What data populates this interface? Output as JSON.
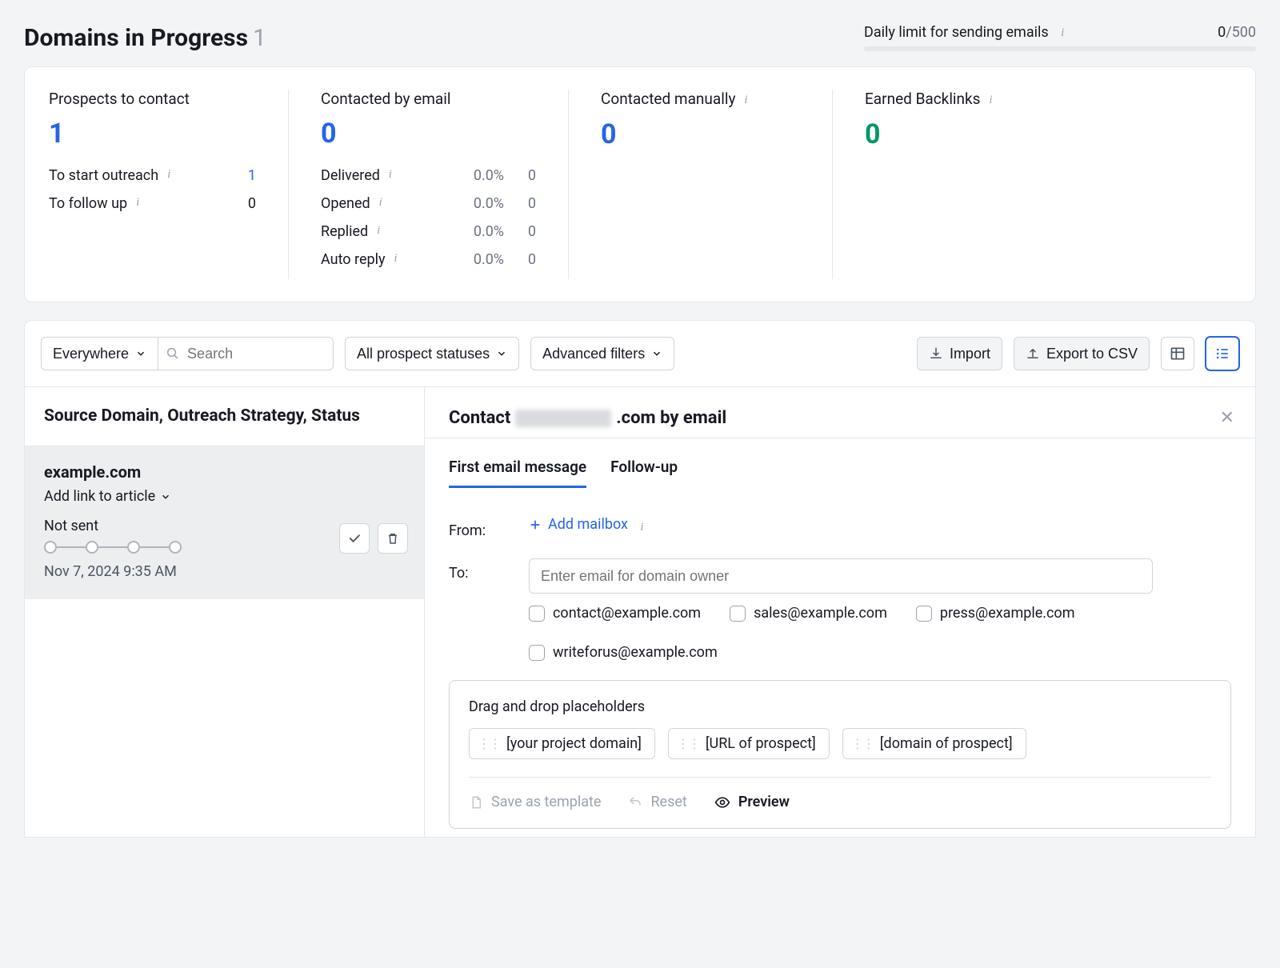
{
  "header": {
    "title": "Domains in Progress",
    "count": "1",
    "limit_label": "Daily limit for sending emails",
    "limit_used": "0",
    "limit_total": "/500"
  },
  "stats": {
    "prospects": {
      "label": "Prospects to contact",
      "value": "1",
      "rows": [
        {
          "label": "To start outreach",
          "value": "1",
          "blue": true
        },
        {
          "label": "To follow up",
          "value": "0",
          "blue": false
        }
      ]
    },
    "emailed": {
      "label": "Contacted by email",
      "value": "0",
      "rows": [
        {
          "label": "Delivered",
          "pct": "0.0%",
          "cnt": "0"
        },
        {
          "label": "Opened",
          "pct": "0.0%",
          "cnt": "0"
        },
        {
          "label": "Replied",
          "pct": "0.0%",
          "cnt": "0"
        },
        {
          "label": "Auto reply",
          "pct": "0.0%",
          "cnt": "0"
        }
      ]
    },
    "manual": {
      "label": "Contacted manually",
      "value": "0"
    },
    "backlinks": {
      "label": "Earned Backlinks",
      "value": "0"
    }
  },
  "toolbar": {
    "scope": "Everywhere",
    "search_placeholder": "Search",
    "status_filter": "All prospect statuses",
    "advanced": "Advanced filters",
    "import": "Import",
    "export": "Export to CSV"
  },
  "left": {
    "heading": "Source Domain, Outreach Strategy, Status",
    "item": {
      "domain": "example.com",
      "add_link": "Add link to article",
      "status": "Not sent",
      "timestamp": "Nov 7, 2024 9:35 AM"
    }
  },
  "right": {
    "title_prefix": "Contact",
    "title_suffix": ".com by email",
    "tabs": {
      "first": "First email message",
      "follow": "Follow-up"
    },
    "from_label": "From:",
    "add_mailbox": "Add mailbox",
    "to_label": "To:",
    "to_placeholder": "Enter email for domain owner",
    "emails": [
      "contact@example.com",
      "sales@example.com",
      "press@example.com",
      "writeforus@example.com"
    ],
    "ph_title": "Drag and drop placeholders",
    "chips": [
      "[your project domain]",
      "[URL of prospect]",
      "[domain of prospect]"
    ],
    "actions": {
      "save": "Save as template",
      "reset": "Reset",
      "preview": "Preview"
    }
  }
}
